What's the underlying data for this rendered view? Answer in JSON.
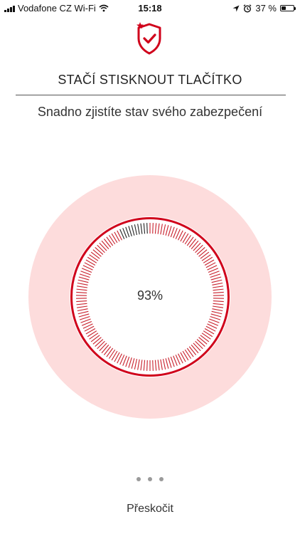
{
  "status_bar": {
    "carrier": "Vodafone CZ Wi-Fi",
    "time": "15:18",
    "battery_text": "37 %",
    "battery_level": 0.37,
    "icons": [
      "signal-icon",
      "wifi-icon",
      "location-icon",
      "alarm-icon",
      "battery-icon"
    ]
  },
  "logo": {
    "icon": "shield-check-icon",
    "color": "#d0021b"
  },
  "header": {
    "title": "STAČÍ STISKNOUT TLAČÍTKO",
    "subtitle": "Snadno zjistíte stav svého zabezpečení"
  },
  "gauge": {
    "value_text": "93%",
    "level": 0.93,
    "colors": {
      "halo": "#fddcdc",
      "ring": "#d0021b",
      "tick_filled": "#c81e2a",
      "tick_empty": "#222222"
    }
  },
  "pager": {
    "count": 3,
    "active_index": 0
  },
  "footer": {
    "skip_label": "Přeskočit"
  }
}
